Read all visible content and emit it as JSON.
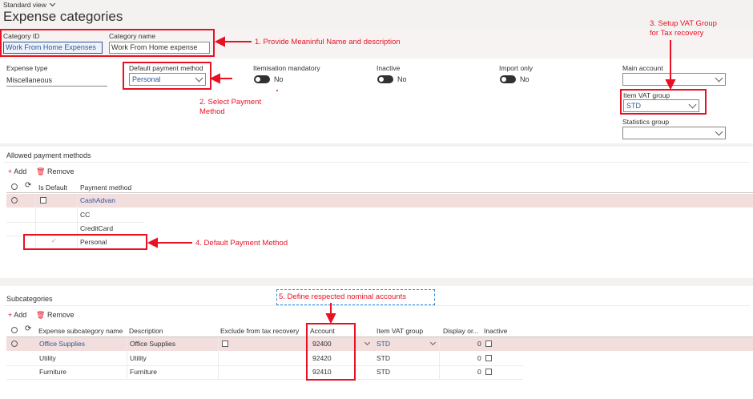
{
  "view": "Standard view",
  "page_title": "Expense categories",
  "header": {
    "category_id_label": "Category ID",
    "category_id_value": "Work From Home Expenses",
    "category_name_label": "Category name",
    "category_name_value": "Work From Home expense"
  },
  "general": {
    "expense_type_label": "Expense type",
    "expense_type_value": "Miscellaneous",
    "default_payment_label": "Default payment method",
    "default_payment_value": "Personal",
    "itemisation_label": "Itemisation mandatory",
    "itemisation_value": "No",
    "inactive_label": "Inactive",
    "inactive_value": "No",
    "import_only_label": "Import only",
    "import_only_value": "No",
    "main_account_label": "Main account",
    "main_account_value": "",
    "item_vat_label": "Item VAT group",
    "item_vat_value": "STD",
    "statistics_label": "Statistics group",
    "statistics_value": ""
  },
  "allowed": {
    "section_title": "Allowed payment methods",
    "add_label": "Add",
    "remove_label": "Remove",
    "col_default": "Is Default",
    "col_method": "Payment method",
    "rows": [
      "CashAdvan",
      "CC",
      "CreditCard",
      "Personal"
    ]
  },
  "sub": {
    "section_title": "Subcategories",
    "add_label": "Add",
    "remove_label": "Remove",
    "cols": [
      "Expense subcategory name",
      "Description",
      "Exclude from tax recovery",
      "Account",
      "Item VAT group",
      "Display or...",
      "Inactive"
    ],
    "rows": [
      {
        "name": "Office Supplies",
        "desc": "Office Supplies",
        "account": "92400",
        "vat": "STD",
        "display": "0"
      },
      {
        "name": "Utility",
        "desc": "Utility",
        "account": "92420",
        "vat": "STD",
        "display": "0"
      },
      {
        "name": "Furniture",
        "desc": "Furniture",
        "account": "92410",
        "vat": "STD",
        "display": "0"
      }
    ]
  },
  "annotations": {
    "a1": "1. Provide Meaninful Name and description",
    "a2_line1": "2. Select Payment",
    "a2_line2": "Method",
    "a3_line1": "3. Setup VAT Group",
    "a3_line2": "for Tax recovery",
    "a4": "4. Default Payment Method",
    "a5": "5. Define respected nominal accounts"
  },
  "colors": {
    "annotation": "#e81123",
    "link": "#2b5797",
    "selected_row": "#f3dede"
  }
}
